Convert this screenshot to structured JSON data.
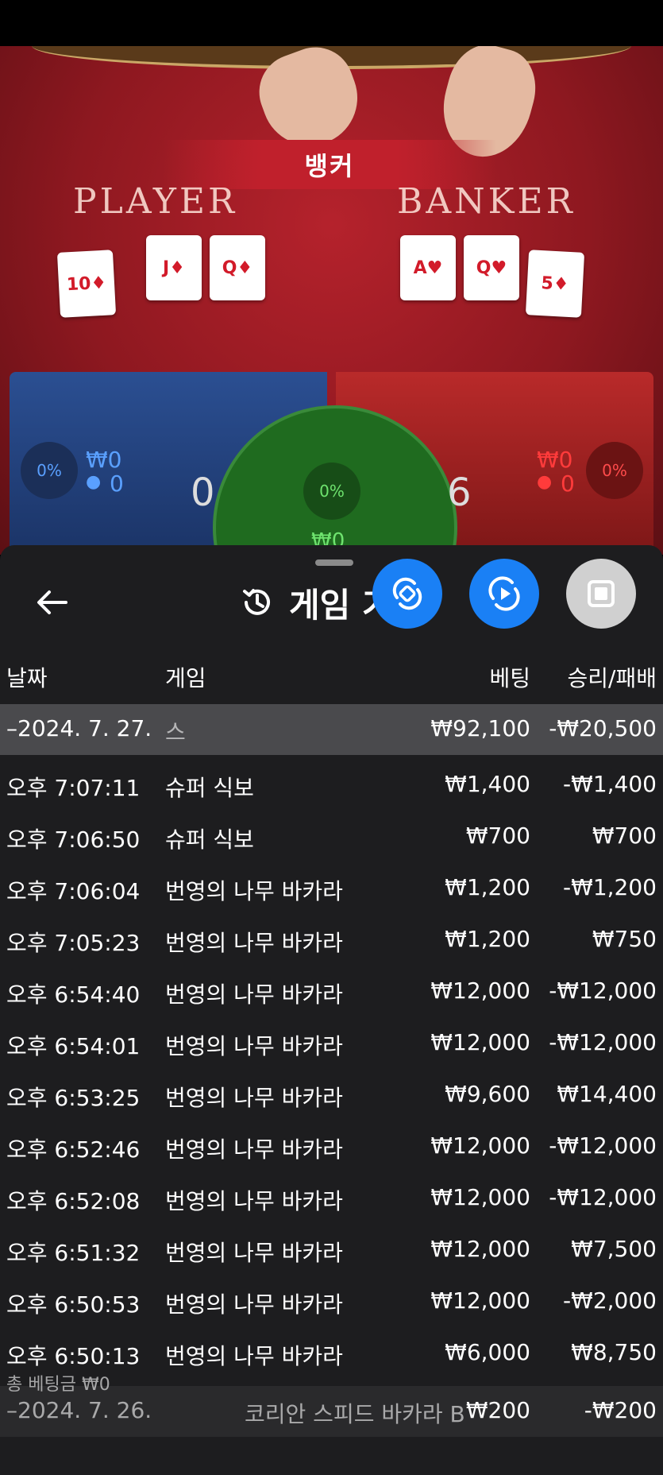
{
  "table": {
    "result_label": "뱅커",
    "player_title": "PLAYER",
    "banker_title": "BANKER",
    "player_cards": [
      "10♦",
      "J♦",
      "Q♦"
    ],
    "banker_cards": [
      "A♥",
      "Q♥",
      "5♦"
    ],
    "player_pct": "0%",
    "player_amount": "₩0",
    "player_count": "0",
    "player_score": "0",
    "tie_pct": "0%",
    "tie_amount": "₩0",
    "banker_pct": "0%",
    "banker_amount": "₩0",
    "banker_count": "0",
    "banker_score": "6"
  },
  "sheet": {
    "title": "게임 기",
    "columns": {
      "date": "날짜",
      "game": "게임",
      "bet": "베팅",
      "winloss": "승리/패배"
    },
    "groups": [
      {
        "date": "–2024. 7. 27.",
        "game": "스",
        "bet": "₩92,100",
        "winloss": "-₩20,500"
      },
      {
        "date": "–2024. 7. 26.",
        "game": "코리안 스피드 바카라 B",
        "bet": "₩200",
        "winloss": "-₩200"
      }
    ],
    "rows": [
      {
        "time": "오후 7:07:11",
        "game": "슈퍼 식보",
        "bet": "₩1,400",
        "winloss": "-₩1,400"
      },
      {
        "time": "오후 7:06:50",
        "game": "슈퍼 식보",
        "bet": "₩700",
        "winloss": "₩700"
      },
      {
        "time": "오후 7:06:04",
        "game": "번영의 나무 바카라",
        "bet": "₩1,200",
        "winloss": "-₩1,200"
      },
      {
        "time": "오후 7:05:23",
        "game": "번영의 나무 바카라",
        "bet": "₩1,200",
        "winloss": "₩750"
      },
      {
        "time": "오후 6:54:40",
        "game": "번영의 나무 바카라",
        "bet": "₩12,000",
        "winloss": "-₩12,000"
      },
      {
        "time": "오후 6:54:01",
        "game": "번영의 나무 바카라",
        "bet": "₩12,000",
        "winloss": "-₩12,000"
      },
      {
        "time": "오후 6:53:25",
        "game": "번영의 나무 바카라",
        "bet": "₩9,600",
        "winloss": "₩14,400"
      },
      {
        "time": "오후 6:52:46",
        "game": "번영의 나무 바카라",
        "bet": "₩12,000",
        "winloss": "-₩12,000"
      },
      {
        "time": "오후 6:52:08",
        "game": "번영의 나무 바카라",
        "bet": "₩12,000",
        "winloss": "-₩12,000"
      },
      {
        "time": "오후 6:51:32",
        "game": "번영의 나무 바카라",
        "bet": "₩12,000",
        "winloss": "₩7,500"
      },
      {
        "time": "오후 6:50:53",
        "game": "번영의 나무 바카라",
        "bet": "₩12,000",
        "winloss": "-₩2,000"
      },
      {
        "time": "오후 6:50:13",
        "game": "번영의 나무 바카라",
        "bet": "₩6,000",
        "winloss": "₩8,750"
      }
    ],
    "footer_text": "총 베팅금 ₩0"
  },
  "colors": {
    "accent_blue": "#1a80f5",
    "sheet_bg": "#1d1d1f",
    "banker_red": "#c0202c",
    "player_blue": "#2b4f92",
    "tie_green": "#1f6b1f"
  },
  "icons": [
    "back-arrow-icon",
    "history-icon",
    "rotate-icon",
    "replay-icon",
    "stop-icon",
    "person-icon"
  ]
}
